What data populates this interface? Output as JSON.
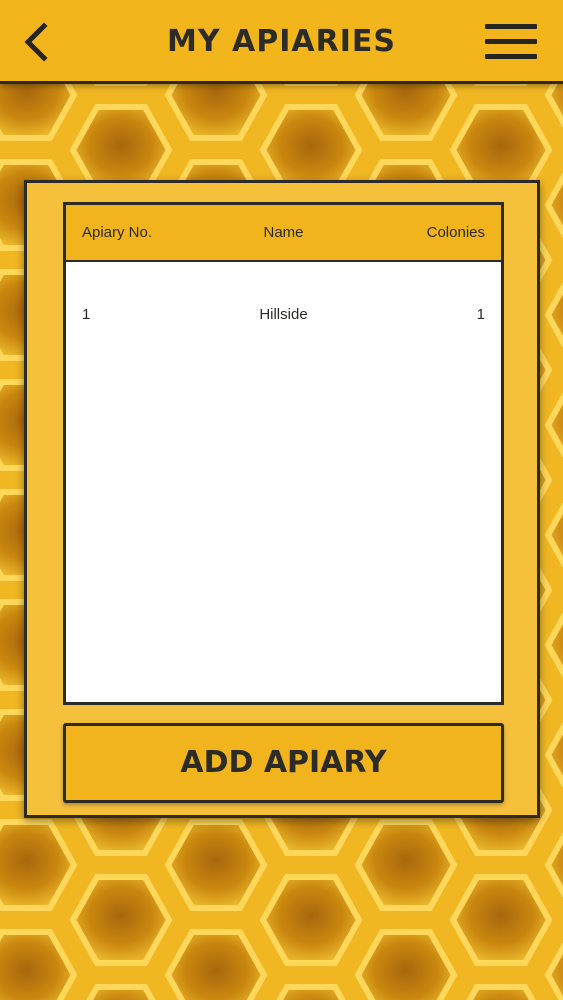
{
  "header": {
    "title": "MY APIARIES"
  },
  "table": {
    "columns": [
      "Apiary No.",
      "Name",
      "Colonies"
    ],
    "rows": [
      {
        "no": "1",
        "name": "Hillside",
        "colonies": "1"
      }
    ]
  },
  "actions": {
    "add_label": "ADD APIARY"
  },
  "colors": {
    "brand_yellow": "#f2b51c",
    "panel_yellow": "#f5c13d",
    "dark": "#2c2b26"
  },
  "icons": {
    "back": "chevron-left-icon",
    "menu": "hamburger-menu-icon"
  }
}
